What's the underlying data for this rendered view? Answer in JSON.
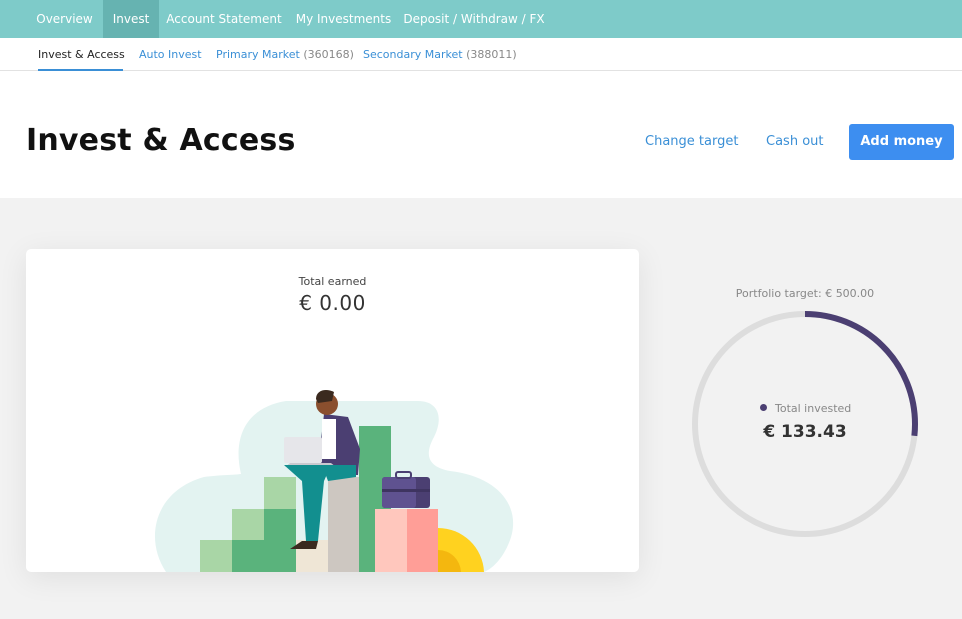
{
  "top_nav": {
    "items": [
      {
        "label": "Overview"
      },
      {
        "label": "Invest"
      },
      {
        "label": "Account Statement"
      },
      {
        "label": "My Investments"
      },
      {
        "label": "Deposit / Withdraw / FX"
      }
    ]
  },
  "sub_nav": {
    "items": [
      {
        "label": "Invest & Access",
        "count": ""
      },
      {
        "label": "Auto Invest",
        "count": ""
      },
      {
        "label": "Primary Market",
        "count": "(360168)"
      },
      {
        "label": "Secondary Market",
        "count": "(388011)"
      }
    ]
  },
  "header": {
    "title": "Invest & Access",
    "change_target": "Change target",
    "cash_out": "Cash out",
    "add_money": "Add money"
  },
  "earned_card": {
    "label": "Total earned",
    "value": "€ 0.00"
  },
  "portfolio": {
    "target_label": "Portfolio target: € 500.00",
    "invested_label": "Total invested",
    "invested_value": "€ 133.43",
    "progress_fraction": 0.267,
    "ring_color": "#4b3f72",
    "track_color": "#dddddd"
  },
  "colors": {
    "accent": "#7ecbc9",
    "link": "#3a8fd6",
    "primary_button": "#3d8ef0"
  }
}
